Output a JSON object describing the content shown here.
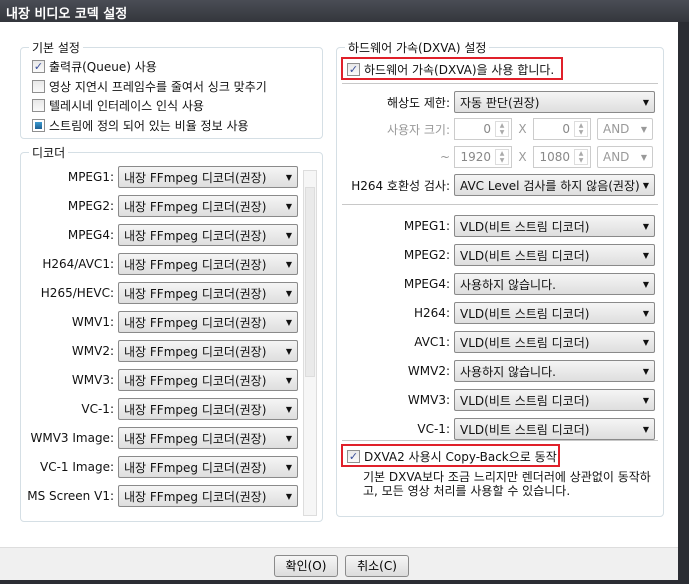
{
  "window": {
    "title": "내장 비디오 코덱 설정"
  },
  "basic": {
    "title": "기본 설정",
    "options": [
      {
        "label": "출력큐(Queue) 사용",
        "state": "checked"
      },
      {
        "label": "영상 지연시 프레임수를 줄여서 싱크 맞추기",
        "state": "unchecked"
      },
      {
        "label": "텔레시네 인터레이스 인식 사용",
        "state": "unchecked"
      },
      {
        "label": "스트림에 정의 되어 있는 비율 정보 사용",
        "state": "indeterminate"
      }
    ]
  },
  "decoder": {
    "title": "디코더",
    "rows": [
      {
        "label": "MPEG1:",
        "value": "내장 FFmpeg 디코더(권장)"
      },
      {
        "label": "MPEG2:",
        "value": "내장 FFmpeg 디코더(권장)"
      },
      {
        "label": "MPEG4:",
        "value": "내장 FFmpeg 디코더(권장)"
      },
      {
        "label": "H264/AVC1:",
        "value": "내장 FFmpeg 디코더(권장)"
      },
      {
        "label": "H265/HEVC:",
        "value": "내장 FFmpeg 디코더(권장)"
      },
      {
        "label": "WMV1:",
        "value": "내장 FFmpeg 디코더(권장)"
      },
      {
        "label": "WMV2:",
        "value": "내장 FFmpeg 디코더(권장)"
      },
      {
        "label": "WMV3:",
        "value": "내장 FFmpeg 디코더(권장)"
      },
      {
        "label": "VC-1:",
        "value": "내장 FFmpeg 디코더(권장)"
      },
      {
        "label": "WMV3 Image:",
        "value": "내장 FFmpeg 디코더(권장)"
      },
      {
        "label": "VC-1 Image:",
        "value": "내장 FFmpeg 디코더(권장)"
      },
      {
        "label": "MS Screen V1:",
        "value": "내장 FFmpeg 디코더(권장)"
      }
    ]
  },
  "dxva": {
    "title": "하드웨어 가속(DXVA) 설정",
    "enable_label": "하드웨어 가속(DXVA)을 사용 합니다.",
    "resolution_label": "해상도 제한:",
    "resolution_value": "자동 판단(권장)",
    "custom_size_label": "사용자 크기:",
    "tilde": "~",
    "x": "X",
    "min_w": "0",
    "min_h": "0",
    "max_w": "1920",
    "max_h": "1080",
    "op1": "AND",
    "op2": "AND",
    "h264_check_label": "H264 호환성 검사:",
    "h264_check_value": "AVC Level 검사를 하지 않음(권장)",
    "rows": [
      {
        "label": "MPEG1:",
        "value": "VLD(비트 스트림 디코더)"
      },
      {
        "label": "MPEG2:",
        "value": "VLD(비트 스트림 디코더)"
      },
      {
        "label": "MPEG4:",
        "value": "사용하지 않습니다."
      },
      {
        "label": "H264:",
        "value": "VLD(비트 스트림 디코더)"
      },
      {
        "label": "AVC1:",
        "value": "VLD(비트 스트림 디코더)"
      },
      {
        "label": "WMV2:",
        "value": "사용하지 않습니다."
      },
      {
        "label": "WMV3:",
        "value": "VLD(비트 스트림 디코더)"
      },
      {
        "label": "VC-1:",
        "value": "VLD(비트 스트림 디코더)"
      }
    ],
    "copyback_label": "DXVA2 사용시 Copy-Back으로 동작",
    "copyback_desc": "기본 DXVA보다 조금 느리지만 렌더러에 상관없이 동작하고, 모든 영상 처리를 사용할 수 있습니다."
  },
  "footer": {
    "ok": "확인(O)",
    "cancel": "취소(C)"
  }
}
